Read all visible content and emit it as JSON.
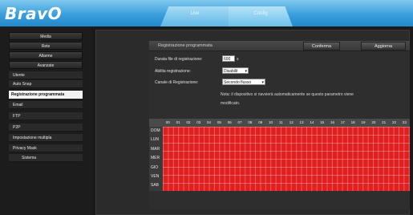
{
  "header": {
    "logo": "BravO",
    "tabs": [
      {
        "label": "Live"
      },
      {
        "label": "Config"
      }
    ]
  },
  "sidebar": {
    "items": [
      {
        "label": "Media"
      },
      {
        "label": "Rete"
      },
      {
        "label": "Allarme"
      },
      {
        "label": "Avanzate"
      },
      {
        "label": "Utente"
      },
      {
        "label": "Auto Snap"
      },
      {
        "label": "Registrazione programmata"
      },
      {
        "label": "Email"
      },
      {
        "label": "FTP"
      },
      {
        "label": "P2P"
      },
      {
        "label": "Impostazione multipla"
      },
      {
        "label": "Privacy Mask"
      },
      {
        "label": "Sistema"
      }
    ]
  },
  "panel": {
    "title": "Registrazione programmata",
    "confirm_label": "Conferma",
    "update_label": "Aggiorna",
    "duration_label": "Durata file di registrazione:",
    "duration_value": "600",
    "duration_unit": "s",
    "enable_label": "Abilita registrazione:",
    "enable_value": "Disabilit",
    "channel_label": "Canale di Registrazione:",
    "channel_value": "Secondo flusso",
    "note_line1": "Nota: il dispositivo si riavvierà automaticamente se questo parametro viene",
    "note_line2": "modificato."
  },
  "schedule": {
    "hours": [
      "00",
      "01",
      "02",
      "03",
      "04",
      "05",
      "06",
      "07",
      "08",
      "09",
      "10",
      "11",
      "12",
      "13",
      "14",
      "15",
      "16",
      "17",
      "18",
      "19",
      "20",
      "21",
      "22",
      "23"
    ],
    "days": [
      "DOM",
      "LUN",
      "MAR",
      "MER",
      "GIO",
      "VEN",
      "SAB"
    ],
    "all_selected": true,
    "selected_color": "#e02020"
  }
}
